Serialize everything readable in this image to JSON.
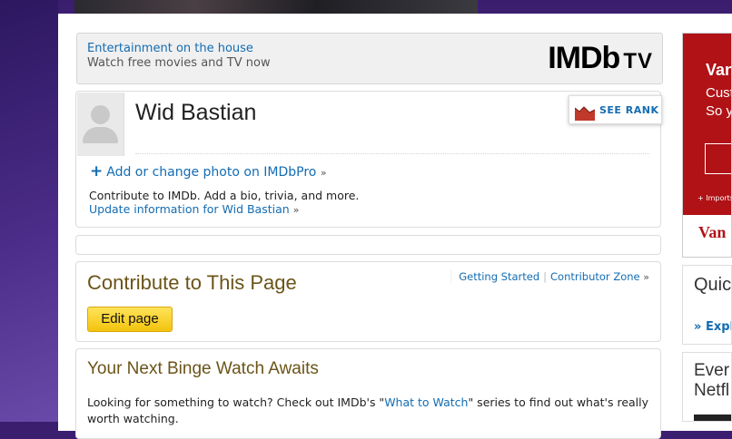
{
  "promo": {
    "line1": "Entertainment on the house",
    "line2": "Watch free movies and TV now",
    "logo_main": "IMDb",
    "logo_tv": "TV"
  },
  "person": {
    "name": "Wid Bastian",
    "see_rank": "SEE RANK",
    "add_photo": "Add or change photo on IMDbPro",
    "contribute_text": "Contribute to IMDb. Add a bio, trivia, and more.",
    "update_link": "Update information for Wid Bastian"
  },
  "contribute": {
    "title": "Contribute to This Page",
    "getting_started": "Getting Started",
    "contributor_zone": "Contributor Zone",
    "edit_button": "Edit page"
  },
  "binge": {
    "title": "Your Next Binge Watch Awaits",
    "text_before": "Looking for something to watch? Check out IMDb's \"",
    "link": "What to Watch",
    "text_after": "\" series to find out what's really worth watching."
  },
  "sidebar_ad": {
    "headline": "Van",
    "line2": "Cust",
    "line3": "So y",
    "fine_print": "+ Imports",
    "brand": "Van"
  },
  "quick_links": {
    "title": "Quic",
    "explore": "Expl"
  },
  "every_box": {
    "line1": "Ever",
    "line2": "Netfl"
  },
  "colors": {
    "link": "#136cb2",
    "heading": "#6b5418",
    "edit_button": "#f5c518",
    "ad_red": "#b01216"
  }
}
